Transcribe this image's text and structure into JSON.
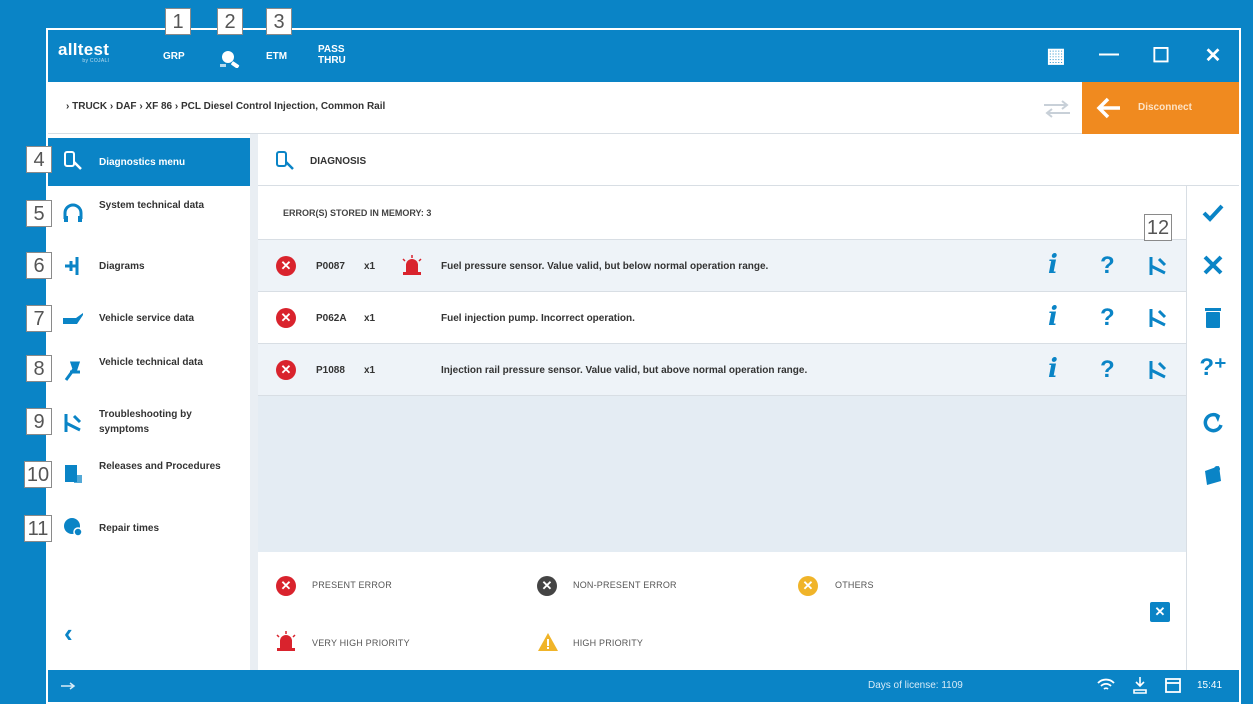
{
  "callouts": [
    "1",
    "2",
    "3",
    "4",
    "5",
    "6",
    "7",
    "8",
    "9",
    "10",
    "11",
    "12"
  ],
  "app": {
    "logo": "alltest",
    "logo_sub": "by COJALI",
    "top_buttons": {
      "grp": "GRP",
      "etm": "ETM",
      "pass": "PASS",
      "thru": "THRU"
    },
    "window": {
      "grid": "▦",
      "minimize": "—",
      "maximize": "☐",
      "close": "✕"
    }
  },
  "breadcrumb": {
    "text": "› TRUCK  ›  DAF  ›  XF 86  ›  PCL Diesel Control Injection, Common Rail",
    "disconnect_label": "Disconnect"
  },
  "sidebar": {
    "items": [
      {
        "label": "Diagnostics menu",
        "icon": "diagnostics-icon"
      },
      {
        "label": "System technical data",
        "icon": "headset-icon"
      },
      {
        "label": "Diagrams",
        "icon": "diagram-icon"
      },
      {
        "label": "Vehicle service data",
        "icon": "oilcan-icon"
      },
      {
        "label": "Vehicle technical data",
        "icon": "wrench-icon"
      },
      {
        "label": "Troubleshooting by symptoms",
        "icon": "tools-icon"
      },
      {
        "label": "Releases and Procedures",
        "icon": "document-icon"
      },
      {
        "label": "Repair times",
        "icon": "clock-gear-icon"
      }
    ],
    "collapse": "‹"
  },
  "main": {
    "title": "DIAGNOSIS",
    "error_header": "ERROR(S) STORED IN MEMORY: 3",
    "errors": [
      {
        "code": "P0087",
        "count": "x1",
        "priority": "very-high",
        "description": "Fuel pressure sensor. Value valid, but below normal operation range."
      },
      {
        "code": "P062A",
        "count": "x1",
        "priority": "",
        "description": "Fuel injection pump. Incorrect operation."
      },
      {
        "code": "P1088",
        "count": "x1",
        "priority": "",
        "description": "Injection rail pressure sensor. Value valid, but above normal operation range."
      }
    ],
    "row_info": "i",
    "row_help": "?"
  },
  "legend": {
    "present": "PRESENT ERROR",
    "non_present": "NON-PRESENT ERROR",
    "others": "OTHERS",
    "very_high": "VERY HIGH PRIORITY",
    "high": "HIGH PRIORITY"
  },
  "right_toolbar": [
    "check-icon",
    "close-icon",
    "trash-icon",
    "help-plus-icon",
    "refresh-icon",
    "report-icon"
  ],
  "status": {
    "days_of_license": "Days of license: 1109",
    "time": "15:41"
  },
  "colors": {
    "primary": "#0a84c6",
    "orange": "#f08a1f",
    "red": "#d9232d",
    "dark": "#333333",
    "amber": "#f0b429"
  }
}
